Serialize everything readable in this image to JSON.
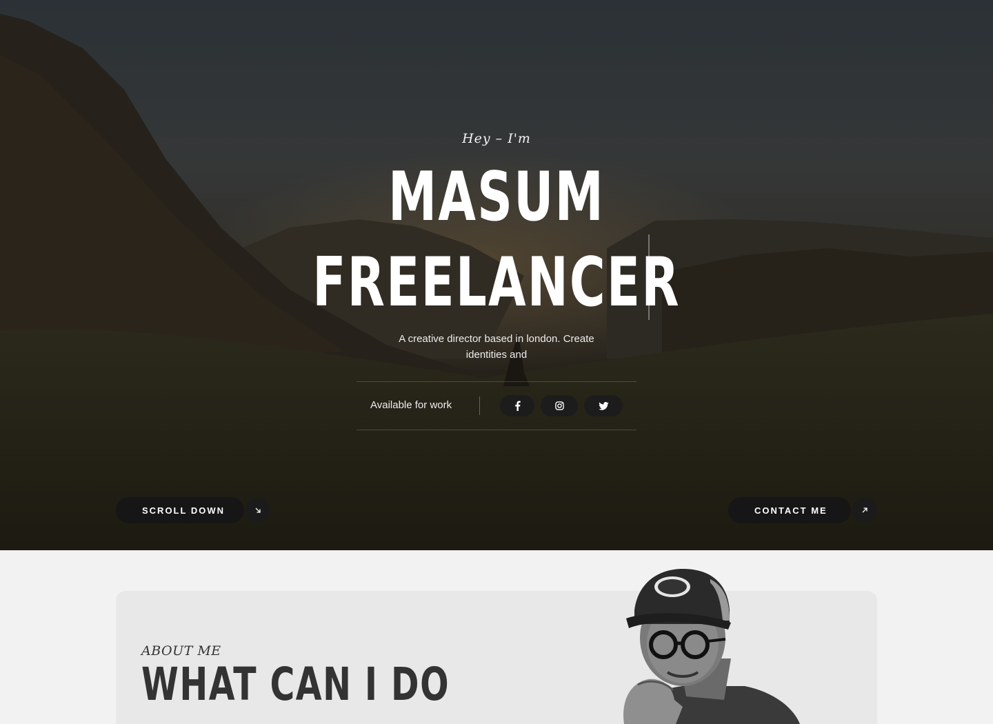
{
  "hero": {
    "greeting": "Hey – I'm",
    "name_line1": "MASUM",
    "name_line2": "FREELANCER",
    "tagline": "A creative director based in london. Create identities and",
    "availability": "Available for work",
    "social": [
      "facebook-icon",
      "instagram-icon",
      "twitter-icon"
    ],
    "scroll_label": "SCROLL DOWN",
    "contact_label": "CONTACT ME"
  },
  "about": {
    "kicker": "ABOUT ME",
    "title": "WHAT CAN I DO"
  },
  "colors": {
    "button_bg": "#161616",
    "about_bg": "#e8e8e8",
    "page_bg": "#f2f2f2",
    "heading_dark": "#333333"
  }
}
